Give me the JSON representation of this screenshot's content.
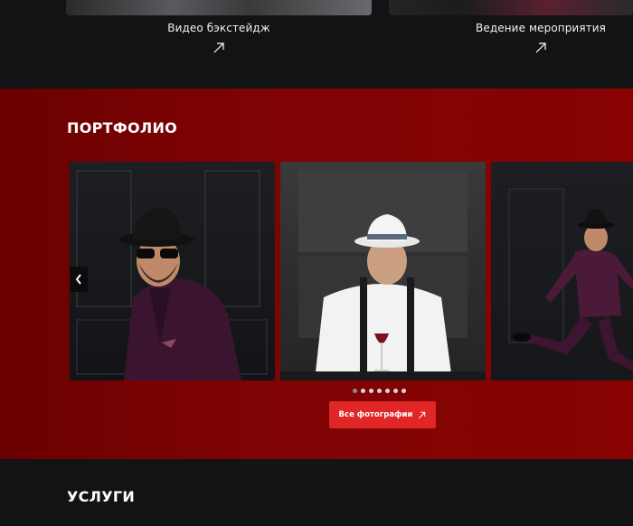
{
  "top_cards": [
    {
      "label": "Видео бэкстейдж"
    },
    {
      "label": "Ведение мероприятия"
    }
  ],
  "portfolio": {
    "title": "ПОРТФОЛИО",
    "slides": [
      {
        "alt": "man-in-black-hat-sunglasses"
      },
      {
        "alt": "man-in-white-hat-with-wine"
      },
      {
        "alt": "man-jumping-in-suit"
      }
    ],
    "dots_count": 7,
    "active_dot": 1,
    "button_label": "Все фотографии"
  },
  "services": {
    "title": "УСЛУГИ"
  },
  "colors": {
    "accent": "#e02626",
    "section_red": "#7d0303",
    "dark": "#121314"
  }
}
